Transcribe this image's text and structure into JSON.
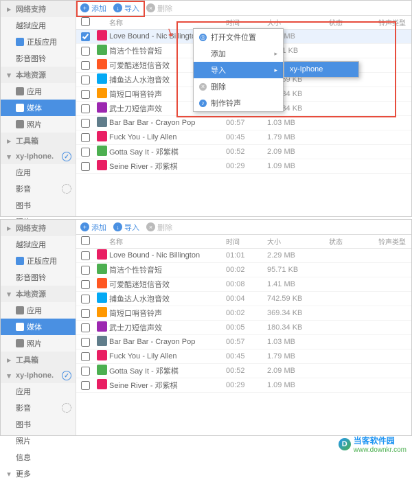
{
  "sidebar": {
    "groups": [
      {
        "label": "网络支持",
        "items": [
          {
            "label": "越狱应用"
          },
          {
            "label": "正版应用",
            "icon": "#4a90e2"
          },
          {
            "label": "影音图铃"
          }
        ]
      },
      {
        "label": "本地资源",
        "items": [
          {
            "label": "应用"
          },
          {
            "label": "媒体",
            "active": true
          },
          {
            "label": "照片"
          }
        ]
      },
      {
        "label": "工具箱",
        "items": []
      },
      {
        "label": "xy-Iphone.",
        "check": true,
        "items": [
          {
            "label": "应用"
          },
          {
            "label": "影音",
            "refresh": true
          },
          {
            "label": "图书"
          },
          {
            "label": "照片"
          },
          {
            "label": "信息"
          },
          {
            "label": "更多"
          }
        ]
      }
    ]
  },
  "toolbar": {
    "add": "添加",
    "import": "导入",
    "delete": "删除"
  },
  "columns": {
    "name": "名称",
    "time": "时间",
    "size": "大小",
    "status": "状态",
    "ringtype": "铃声类型"
  },
  "rows": [
    {
      "name": "Love Bound - Nic Billington",
      "time": "01:01",
      "size": "2.29 MB",
      "color": "#e91e63",
      "sel": true
    },
    {
      "name": "简洁个性铃音短",
      "time": "00:02",
      "size": "95.71 KB",
      "color": "#4caf50"
    },
    {
      "name": "可爱酷迷短信音效",
      "time": "00:08",
      "size": "1.41 MB",
      "color": "#ff5722"
    },
    {
      "name": "捕鱼达人水泡音效",
      "time": "00:04",
      "size": "742.59 KB",
      "color": "#03a9f4"
    },
    {
      "name": "简短口哨音铃声",
      "time": "00:02",
      "size": "369.34 KB",
      "color": "#ff9800"
    },
    {
      "name": "武士刀短信声效",
      "time": "00:05",
      "size": "180.34 KB",
      "color": "#9c27b0"
    },
    {
      "name": "Bar Bar Bar - Crayon Pop",
      "time": "00:57",
      "size": "1.03 MB",
      "color": "#607d8b"
    },
    {
      "name": "Fuck You - Lily Allen",
      "time": "00:45",
      "size": "1.79 MB",
      "color": "#e91e63"
    },
    {
      "name": "Gotta Say It - 邓紫棋",
      "time": "00:52",
      "size": "2.09 MB",
      "color": "#4caf50"
    },
    {
      "name": "Seine River - 邓紫棋",
      "time": "00:29",
      "size": "1.09 MB",
      "color": "#e91e63"
    }
  ],
  "context": {
    "open": "打开文件位置",
    "add": "添加",
    "import": "导入",
    "delete": "删除",
    "make": "制作铃声"
  },
  "submenu": {
    "item": "xy-Iphone"
  },
  "footer": {
    "cn": "当客软件园",
    "url": "www.downkr.com",
    "glyph": "D"
  }
}
